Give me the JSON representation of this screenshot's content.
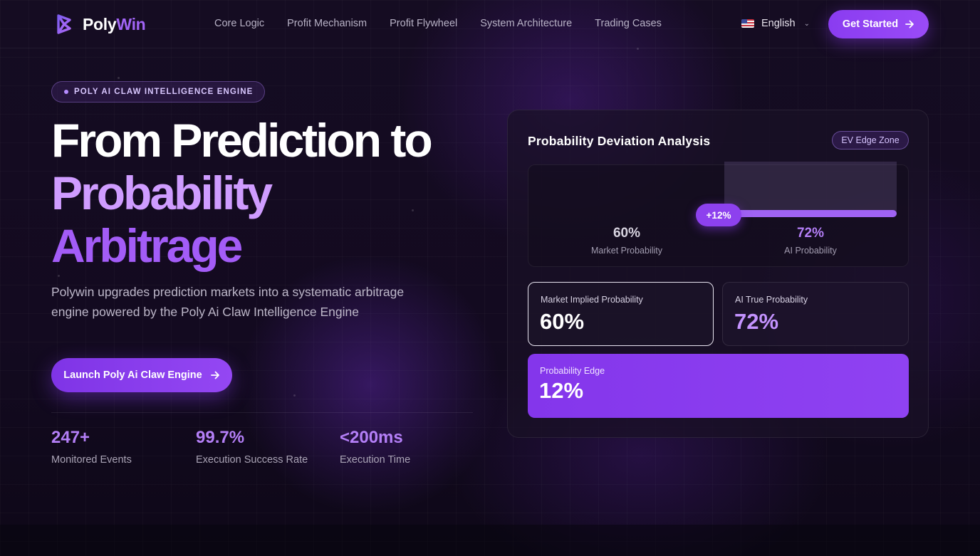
{
  "nav": {
    "logo_poly": "Poly",
    "logo_win": "Win",
    "links": [
      "Core Logic",
      "Profit Mechanism",
      "Profit Flywheel",
      "System Architecture",
      "Trading Cases"
    ],
    "language": "English",
    "cta_label": "Get Started"
  },
  "hero": {
    "badge": "POLY AI CLAW INTELLIGENCE ENGINE",
    "title_line1": "From Prediction to",
    "title_line2": "Probability",
    "title_line3": "Arbitrage",
    "subtitle": "Polywin upgrades prediction markets into a systematic arbitrage engine powered by the Poly Ai Claw Intelligence Engine",
    "button_label": "Launch Poly Ai Claw Engine",
    "stats": [
      {
        "value": "247+",
        "label": "Monitored Events"
      },
      {
        "value": "99.7%",
        "label": "Execution Success Rate"
      },
      {
        "value": "<200ms",
        "label": "Execution Time"
      }
    ]
  },
  "analysis": {
    "title": "Probability Deviation Analysis",
    "tag": "EV Edge Zone",
    "delta_label": "+12%",
    "market_value": "60%",
    "market_label": "Market Probability",
    "ai_value": "72%",
    "ai_label": "AI Probability",
    "market_implied_label": "Market Implied Probability",
    "market_implied_value": "60%",
    "ai_true_label": "AI True Probability",
    "ai_true_value": "72%",
    "edge_label": "Probability Edge",
    "edge_value": "12%"
  },
  "colors": {
    "accent": "#9a4bf7",
    "accent_light": "#cf9cff",
    "background": "#100a1c"
  }
}
